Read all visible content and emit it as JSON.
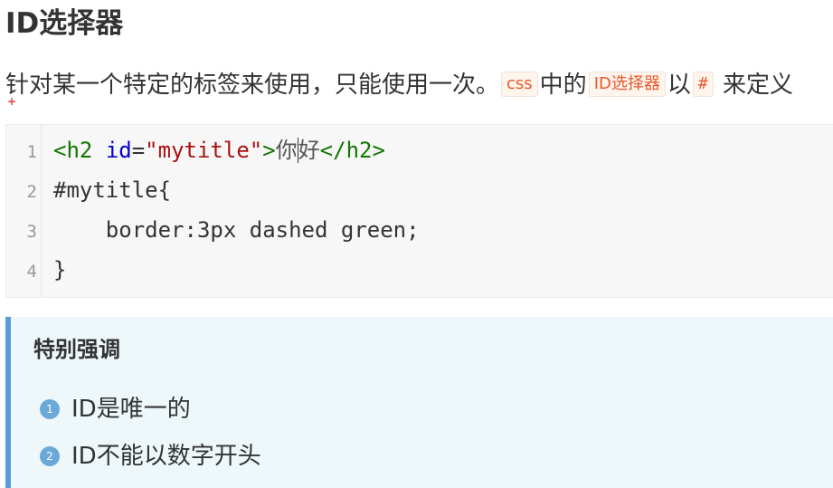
{
  "heading": "ID选择器",
  "description": {
    "part1": "针对某一个特定的标签来使用，只能使用一次。",
    "code1": "css",
    "part2": "中的",
    "code2": "ID选择器",
    "part3": "以",
    "code3": "#",
    "part4": "来定义"
  },
  "code_block": {
    "line_numbers": [
      "1",
      "2",
      "3",
      "4"
    ],
    "line1": {
      "open_tag": "<h2",
      "attr": "id",
      "eq": "=",
      "value": "\"mytitle\"",
      "close_open": ">",
      "text_a": "你",
      "text_b": "好",
      "end_tag": "</h2>"
    },
    "line2": "#mytitle{",
    "line3": "    border:3px dashed green;",
    "line4": "}"
  },
  "callout": {
    "title": "特别强调",
    "items": [
      {
        "number": "1",
        "text": "ID是唯一的"
      },
      {
        "number": "2",
        "text": "ID不能以数字开头"
      }
    ]
  },
  "colors": {
    "callout_border": "#5b9bd5",
    "callout_background": "#eef8fb",
    "inline_code_text": "#e8592b",
    "code_background": "#f7f7f7"
  }
}
